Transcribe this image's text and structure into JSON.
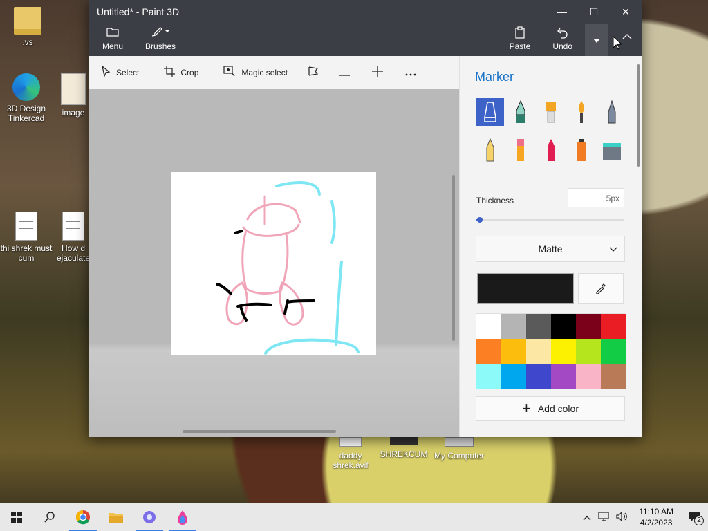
{
  "desktop": {
    "icons": [
      {
        "label": ".vs"
      },
      {
        "label": "3D Design Tinkercad"
      },
      {
        "label": "image"
      },
      {
        "label": "thi shrek must cum"
      },
      {
        "label": "How d ejaculate"
      },
      {
        "label": "daddy shrek.avif"
      },
      {
        "label": "SHREKCUM"
      },
      {
        "label": "My Computer"
      }
    ]
  },
  "window": {
    "title": "Untitled* - Paint 3D",
    "controls": {
      "minimize": "—",
      "maximize": "☐",
      "close": "✕"
    }
  },
  "ribbon": {
    "menu_label": "Menu",
    "brushes_label": "Brushes",
    "paste_label": "Paste",
    "undo_label": "Undo"
  },
  "toolbar": {
    "select_label": "Select",
    "crop_label": "Crop",
    "magic_select_label": "Magic select"
  },
  "panel": {
    "title": "Marker",
    "thickness_label": "Thickness",
    "thickness_value": "5px",
    "thickness_fraction": 0.02,
    "finish": "Matte",
    "current_color": "#1a1a1a",
    "add_color_label": "Add color",
    "palette": [
      "#ffffff",
      "#b4b4b4",
      "#5a5a5a",
      "#000000",
      "#7b0019",
      "#ea1c24",
      "#fc7f23",
      "#fcbd0d",
      "#fce8a4",
      "#fcf100",
      "#b5e61d",
      "#11cc44",
      "#8cfaf9",
      "#00a6ee",
      "#3f48cc",
      "#a349c3",
      "#fab4c8",
      "#b97a57"
    ]
  },
  "taskbar": {
    "time": "11:10 AM",
    "date": "4/2/2023",
    "notifications": "2"
  }
}
